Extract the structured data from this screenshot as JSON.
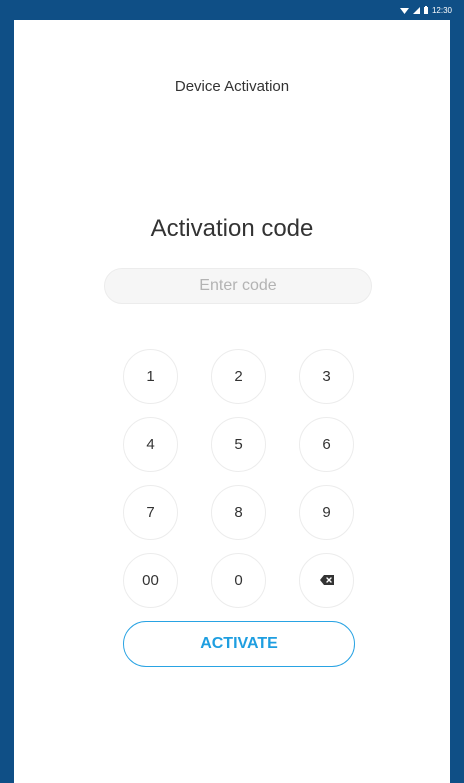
{
  "status_bar": {
    "time": "12:30",
    "icons": [
      "wifi-icon",
      "signal-icon",
      "battery-icon"
    ]
  },
  "header": {
    "title": "Device Activation"
  },
  "main": {
    "title": "Activation code",
    "input": {
      "placeholder": "Enter code",
      "value": ""
    },
    "keypad": {
      "keys": [
        "1",
        "2",
        "3",
        "4",
        "5",
        "6",
        "7",
        "8",
        "9",
        "00",
        "0"
      ],
      "backspace_icon": "backspace-icon"
    },
    "activate_label": "ACTIVATE"
  },
  "colors": {
    "frame": "#0f4f86",
    "accent": "#29a3e3",
    "text": "#333333"
  }
}
